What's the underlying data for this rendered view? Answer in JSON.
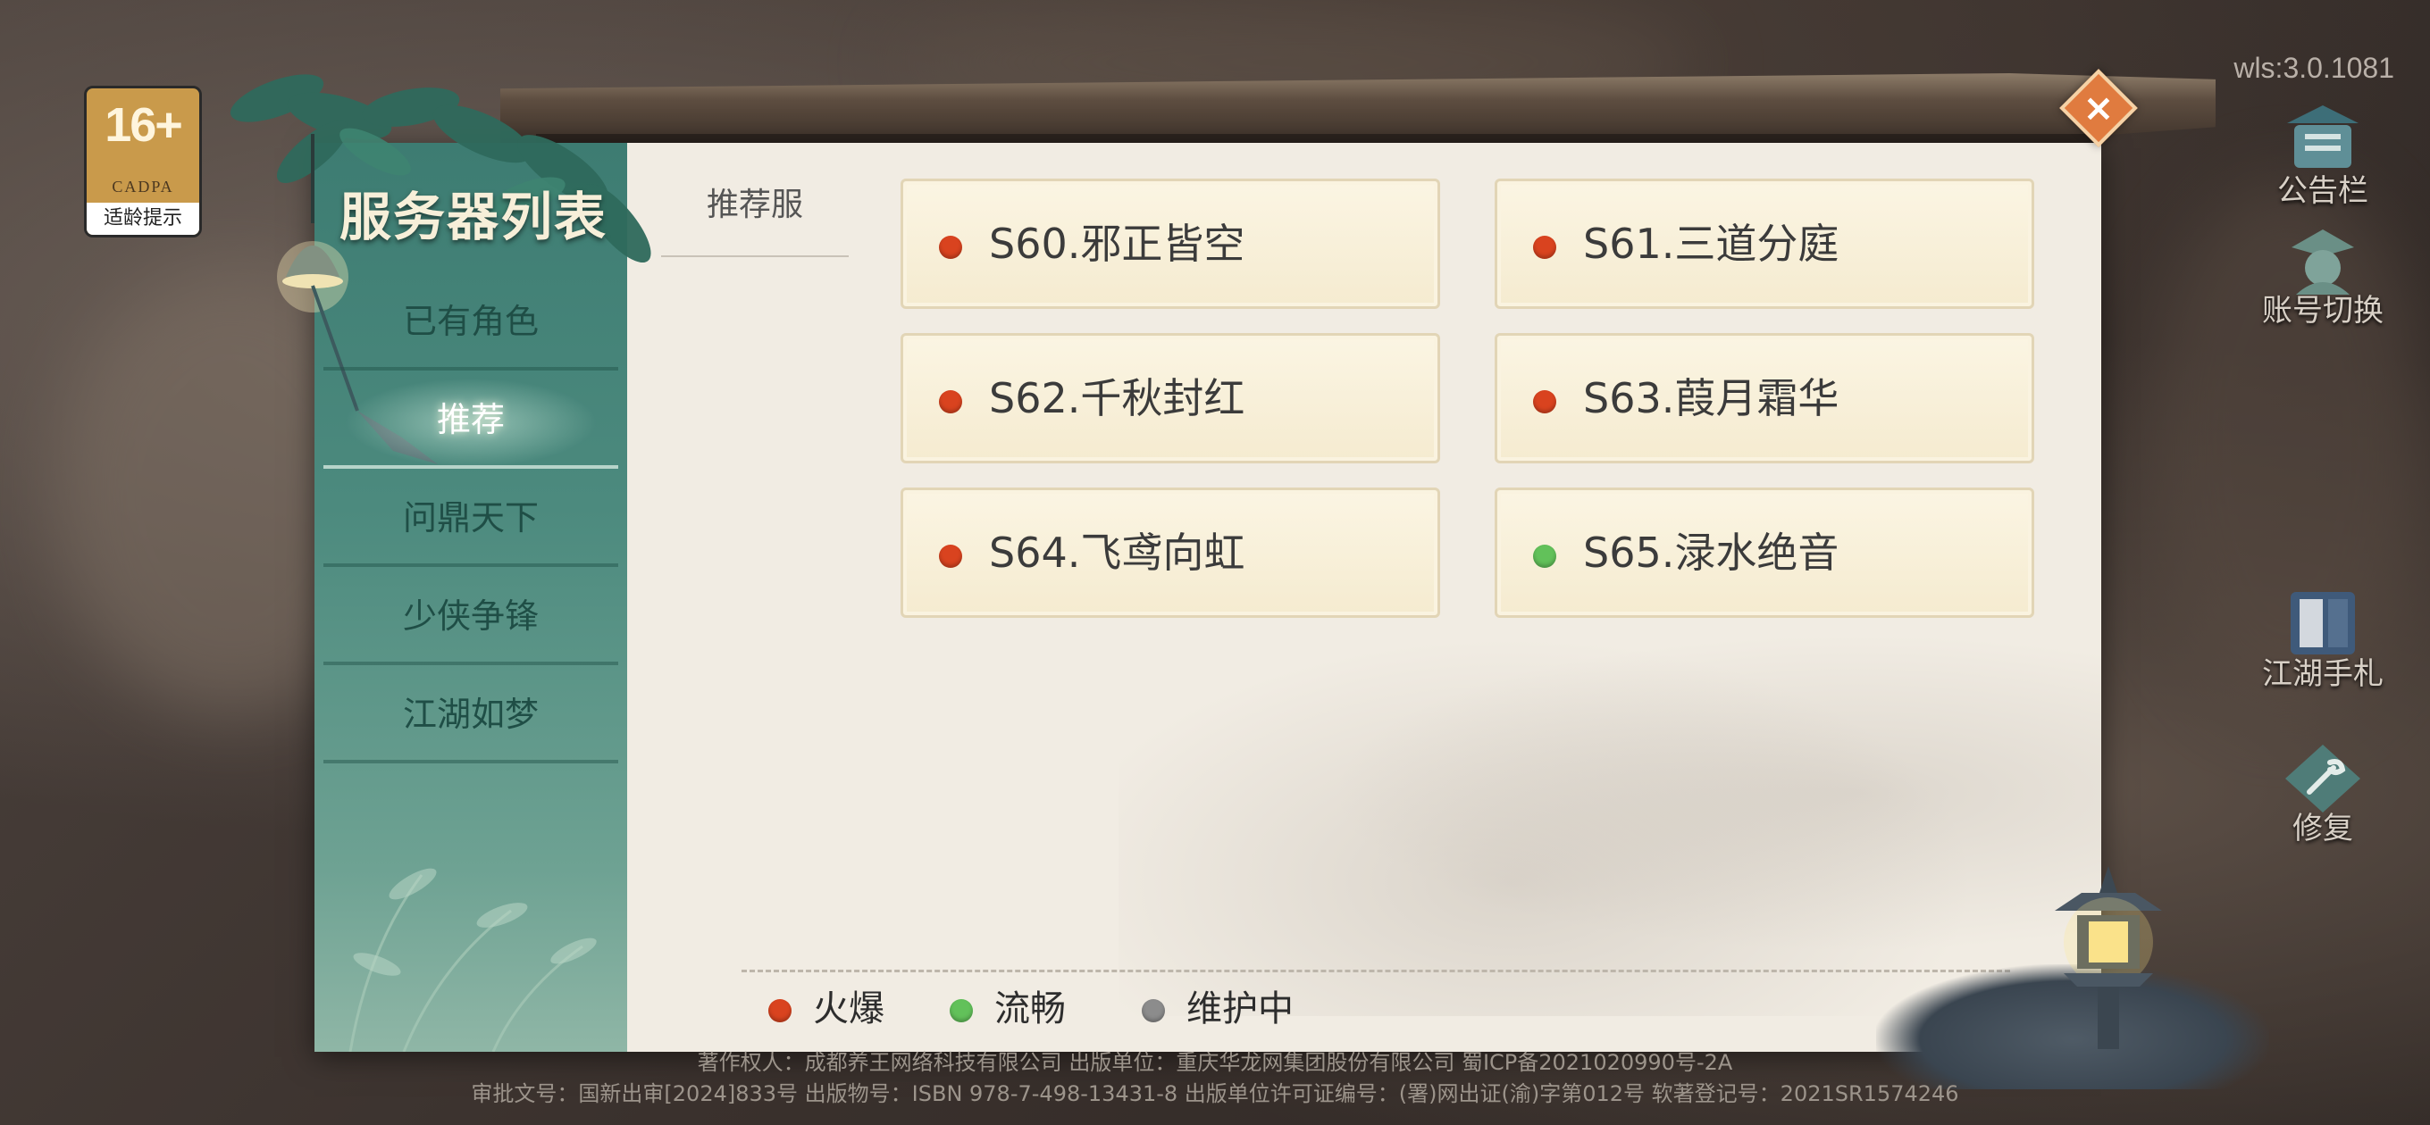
{
  "age_rating": {
    "number": "16+",
    "org": "CADPA",
    "tip": "适龄提示"
  },
  "version": "wls:3.0.1081",
  "right_menu": [
    {
      "label": "公告栏",
      "icon": "notice-board-icon"
    },
    {
      "label": "账号切换",
      "icon": "account-switch-icon"
    },
    {
      "label": "江湖手札",
      "icon": "journal-icon"
    },
    {
      "label": "修复",
      "icon": "repair-icon"
    }
  ],
  "sidebar": {
    "title": "服务器列表",
    "items": [
      {
        "label": "已有角色"
      },
      {
        "label": "推荐",
        "active": true
      },
      {
        "label": "问鼎天下"
      },
      {
        "label": "少侠争锋"
      },
      {
        "label": "江湖如梦"
      }
    ]
  },
  "category_tab": "推荐服",
  "servers": [
    {
      "name": "S60.邪正皆空",
      "status": "hot"
    },
    {
      "name": "S61.三道分庭",
      "status": "hot"
    },
    {
      "name": "S62.千秋封红",
      "status": "hot"
    },
    {
      "name": "S63.葭月霜华",
      "status": "hot"
    },
    {
      "name": "S64.飞鸢向虹",
      "status": "hot"
    },
    {
      "name": "S65.渌水绝音",
      "status": "smooth"
    }
  ],
  "legend": [
    {
      "label": "火爆",
      "color": "#d9431f"
    },
    {
      "label": "流畅",
      "color": "#62c15a"
    },
    {
      "label": "维护中",
      "color": "#8c8c8c"
    }
  ],
  "status_colors": {
    "hot": "#d9431f",
    "smooth": "#62c15a",
    "maintenance": "#8c8c8c"
  },
  "copyright": {
    "line1": "著作权人：成都养王网络科技有限公司  出版单位：重庆华龙网集团股份有限公司  蜀ICP备2021020990号-2A",
    "line2": "审批文号：国新出审[2024]833号  出版物号：ISBN 978-7-498-13431-8 出版单位许可证编号：(署)网出证(渝)字第012号 软著登记号：2021SR1574246"
  }
}
